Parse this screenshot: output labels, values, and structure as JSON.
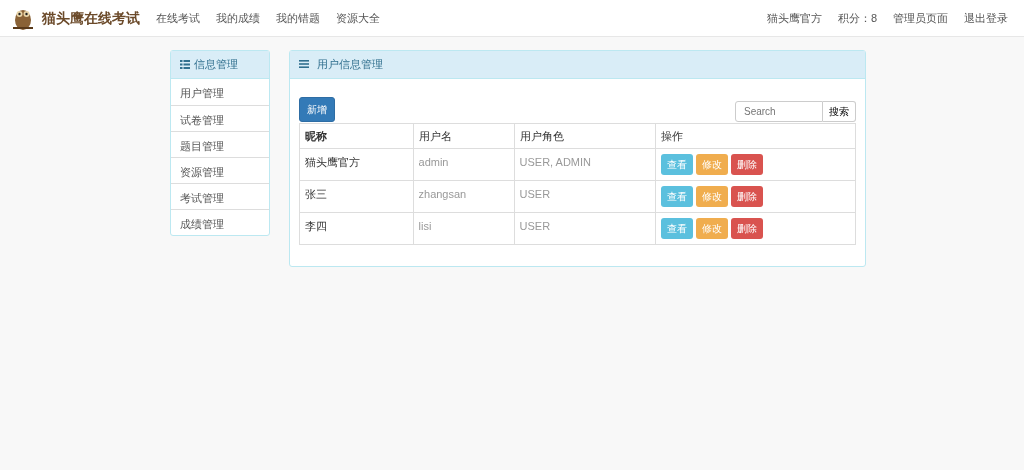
{
  "navbar": {
    "brand": "猫头鹰在线考试",
    "links": [
      {
        "label": "在线考试"
      },
      {
        "label": "我的成绩"
      },
      {
        "label": "我的错题"
      },
      {
        "label": "资源大全"
      }
    ],
    "right_links": [
      {
        "label": "猫头鹰官方"
      },
      {
        "label": "积分：8"
      },
      {
        "label": "管理员页面"
      },
      {
        "label": "退出登录"
      }
    ]
  },
  "sidebar": {
    "title": "信息管理",
    "items": [
      {
        "label": "用户管理"
      },
      {
        "label": "试卷管理"
      },
      {
        "label": "题目管理"
      },
      {
        "label": "资源管理"
      },
      {
        "label": "考试管理"
      },
      {
        "label": "成绩管理"
      }
    ]
  },
  "panel": {
    "title": "用户信息管理",
    "add_button": "新增",
    "search": {
      "placeholder": "Search",
      "button": "搜索"
    },
    "table": {
      "columns": [
        "昵称",
        "用户名",
        "用户角色",
        "操作"
      ],
      "rows": [
        {
          "nickname": "猫头鹰官方",
          "username": "admin",
          "roles": "USER, ADMIN",
          "actions": [
            {
              "kind": "view",
              "label": "查看"
            },
            {
              "kind": "edit",
              "label": "修改"
            },
            {
              "kind": "delete",
              "label": "删除"
            }
          ]
        },
        {
          "nickname": "张三",
          "username": "zhangsan",
          "roles": "USER",
          "actions": [
            {
              "kind": "view",
              "label": "查看"
            },
            {
              "kind": "edit",
              "label": "修改"
            },
            {
              "kind": "delete",
              "label": "删除"
            }
          ]
        },
        {
          "nickname": "李四",
          "username": "lisi",
          "roles": "USER",
          "actions": [
            {
              "kind": "view",
              "label": "查看"
            },
            {
              "kind": "edit",
              "label": "修改"
            },
            {
              "kind": "delete",
              "label": "删除"
            }
          ]
        }
      ]
    }
  }
}
